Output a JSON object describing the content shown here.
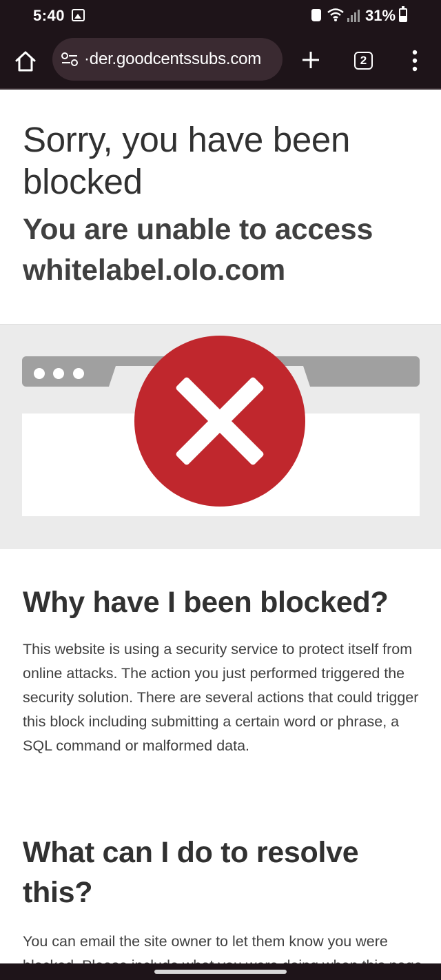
{
  "status_bar": {
    "time": "5:40",
    "battery": "31%",
    "icons": [
      "image-icon",
      "lock-icon",
      "wifi-icon",
      "signal-icon",
      "battery-icon"
    ]
  },
  "toolbar": {
    "url": "·der.goodcentssubs.com",
    "tab_count": "2",
    "icons": [
      "home-icon",
      "site-settings-icon",
      "new-tab-icon",
      "menu-icon"
    ]
  },
  "page": {
    "title": "Sorry, you have been blocked",
    "subtitle": "You are unable to access whitelabel.olo.com",
    "why_heading": "Why have I been blocked?",
    "why_body": "This website is using a security service to protect itself from online attacks. The action you just performed triggered the security solution. There are several actions that could trigger this block including submitting a certain word or phrase, a SQL command or malformed data.",
    "resolve_heading": "What can I do to resolve this?",
    "resolve_body": "You can email the site owner to let them know you were blocked. Please include what you were doing when this page came up and the Cloudflare Ray ID found at the bottom of this page."
  },
  "colors": {
    "chrome_bg": "#1e1419",
    "url_pill_bg": "#3a2a31",
    "error_red": "#c0272d",
    "illustration_bg": "#ebebeb",
    "browser_frame_gray": "#a0a0a0",
    "text_dark": "#313131"
  }
}
